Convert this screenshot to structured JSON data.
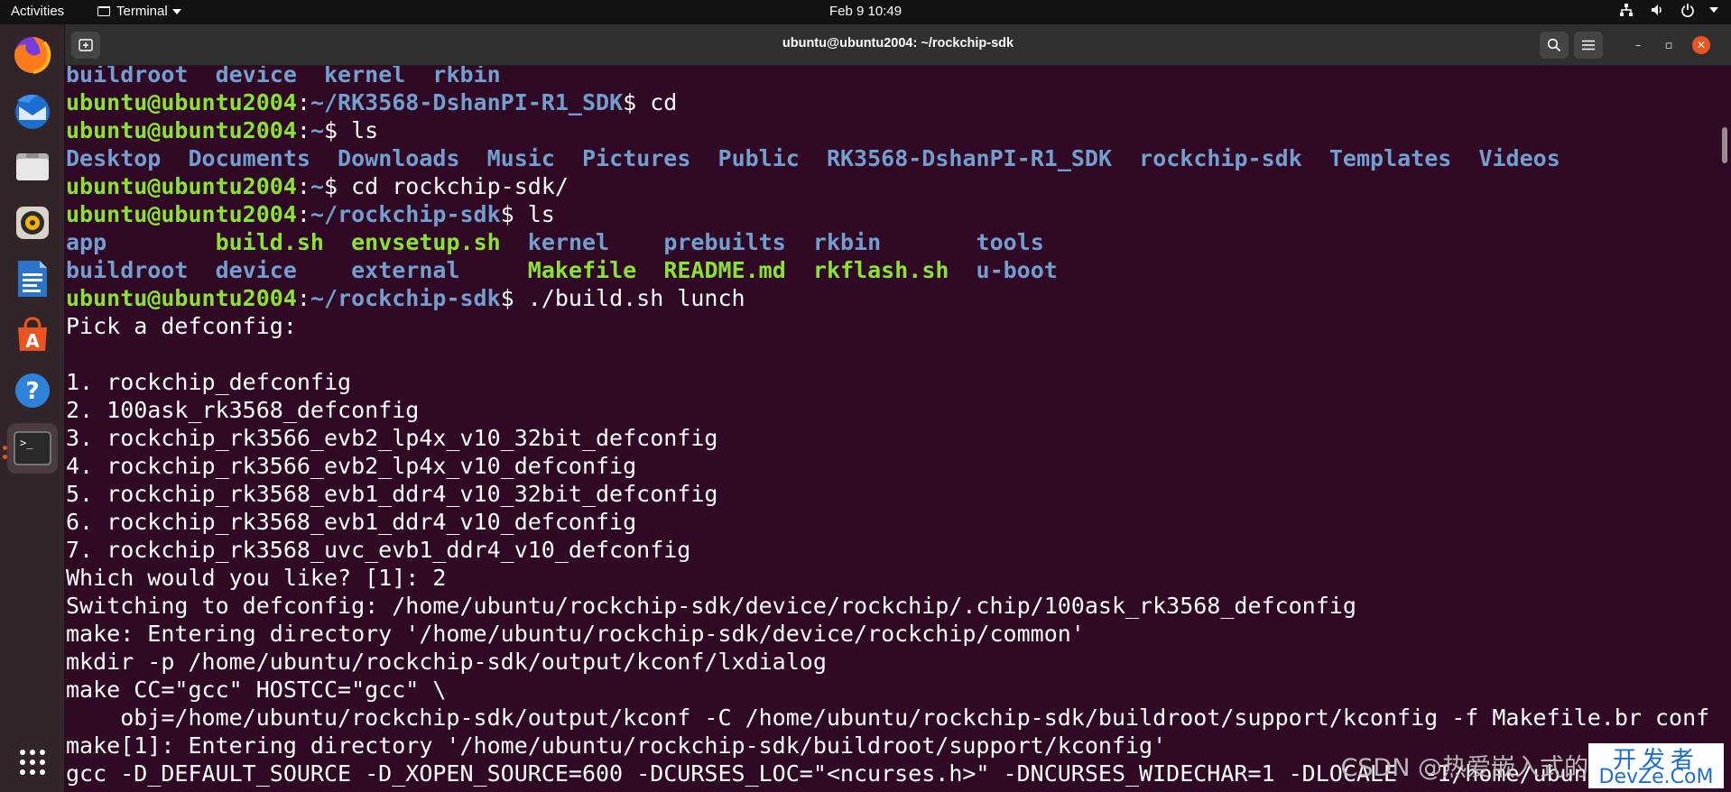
{
  "topbar": {
    "activities": "Activities",
    "app_name": "Terminal",
    "datetime": "Feb 9  10:49",
    "tray_icons": [
      "network-icon",
      "volume-icon",
      "power-icon",
      "chevron-down-icon"
    ]
  },
  "dock": {
    "items": [
      {
        "name": "firefox-icon",
        "running": false
      },
      {
        "name": "thunderbird-icon",
        "running": false
      },
      {
        "name": "files-icon",
        "running": false
      },
      {
        "name": "rhythmbox-icon",
        "running": false
      },
      {
        "name": "writer-icon",
        "running": false
      },
      {
        "name": "software-store-icon",
        "running": false
      },
      {
        "name": "help-icon",
        "running": false
      },
      {
        "name": "terminal-icon",
        "running": true
      }
    ],
    "show_apps": "apps-grid-icon"
  },
  "window": {
    "title": "ubuntu@ubuntu2004: ~/rockchip-sdk",
    "new_tab_icon": "new-tab-icon",
    "search_icon": "search-icon",
    "menu_icon": "hamburger-menu-icon",
    "minimize": "–",
    "maximize": "▫",
    "close": "✕"
  },
  "colors": {
    "terminal_bg": "#300a24",
    "user_host": "#8ae234",
    "path": "#729fcf",
    "directory": "#729fcf",
    "executable": "#8ae234",
    "text": "#ffffff",
    "accent": "#e95420"
  },
  "terminal": {
    "lines": [
      [
        {
          "t": "buildroot",
          "c": "dir"
        },
        {
          "t": "  "
        },
        {
          "t": "device",
          "c": "dir"
        },
        {
          "t": "  "
        },
        {
          "t": "kernel",
          "c": "dir"
        },
        {
          "t": "  "
        },
        {
          "t": "rkbin",
          "c": "dir"
        }
      ],
      [
        {
          "t": "ubuntu@ubuntu2004",
          "c": "pu"
        },
        {
          "t": ":"
        },
        {
          "t": "~/RK3568-DshanPI-R1_SDK",
          "c": "pp"
        },
        {
          "t": "$ cd"
        }
      ],
      [
        {
          "t": "ubuntu@ubuntu2004",
          "c": "pu"
        },
        {
          "t": ":"
        },
        {
          "t": "~",
          "c": "pp"
        },
        {
          "t": "$ ls"
        }
      ],
      [
        {
          "t": "Desktop",
          "c": "dir"
        },
        {
          "t": "  "
        },
        {
          "t": "Documents",
          "c": "dir"
        },
        {
          "t": "  "
        },
        {
          "t": "Downloads",
          "c": "dir"
        },
        {
          "t": "  "
        },
        {
          "t": "Music",
          "c": "dir"
        },
        {
          "t": "  "
        },
        {
          "t": "Pictures",
          "c": "dir"
        },
        {
          "t": "  "
        },
        {
          "t": "Public",
          "c": "dir"
        },
        {
          "t": "  "
        },
        {
          "t": "RK3568-DshanPI-R1_SDK",
          "c": "dir"
        },
        {
          "t": "  "
        },
        {
          "t": "rockchip-sdk",
          "c": "dir"
        },
        {
          "t": "  "
        },
        {
          "t": "Templates",
          "c": "dir"
        },
        {
          "t": "  "
        },
        {
          "t": "Videos",
          "c": "dir"
        }
      ],
      [
        {
          "t": "ubuntu@ubuntu2004",
          "c": "pu"
        },
        {
          "t": ":"
        },
        {
          "t": "~",
          "c": "pp"
        },
        {
          "t": "$ cd rockchip-sdk/"
        }
      ],
      [
        {
          "t": "ubuntu@ubuntu2004",
          "c": "pu"
        },
        {
          "t": ":"
        },
        {
          "t": "~/rockchip-sdk",
          "c": "pp"
        },
        {
          "t": "$ ls"
        }
      ],
      [
        {
          "t": "app",
          "c": "dir"
        },
        {
          "t": "        "
        },
        {
          "t": "build.sh",
          "c": "exe"
        },
        {
          "t": "  "
        },
        {
          "t": "envsetup.sh",
          "c": "exe"
        },
        {
          "t": "  "
        },
        {
          "t": "kernel",
          "c": "dir"
        },
        {
          "t": "    "
        },
        {
          "t": "prebuilts",
          "c": "dir"
        },
        {
          "t": "  "
        },
        {
          "t": "rkbin",
          "c": "dir"
        },
        {
          "t": "       "
        },
        {
          "t": "tools",
          "c": "dir"
        }
      ],
      [
        {
          "t": "buildroot",
          "c": "dir"
        },
        {
          "t": "  "
        },
        {
          "t": "device",
          "c": "dir"
        },
        {
          "t": "    "
        },
        {
          "t": "external",
          "c": "dir"
        },
        {
          "t": "     "
        },
        {
          "t": "Makefile",
          "c": "exe"
        },
        {
          "t": "  "
        },
        {
          "t": "README.md",
          "c": "exe"
        },
        {
          "t": "  "
        },
        {
          "t": "rkflash.sh",
          "c": "exe"
        },
        {
          "t": "  "
        },
        {
          "t": "u-boot",
          "c": "dir"
        }
      ],
      [
        {
          "t": "ubuntu@ubuntu2004",
          "c": "pu"
        },
        {
          "t": ":"
        },
        {
          "t": "~/rockchip-sdk",
          "c": "pp"
        },
        {
          "t": "$ ./build.sh lunch"
        }
      ],
      [
        {
          "t": "Pick a defconfig:"
        }
      ],
      [
        {
          "t": ""
        }
      ],
      [
        {
          "t": "1. rockchip_defconfig"
        }
      ],
      [
        {
          "t": "2. 100ask_rk3568_defconfig"
        }
      ],
      [
        {
          "t": "3. rockchip_rk3566_evb2_lp4x_v10_32bit_defconfig"
        }
      ],
      [
        {
          "t": "4. rockchip_rk3566_evb2_lp4x_v10_defconfig"
        }
      ],
      [
        {
          "t": "5. rockchip_rk3568_evb1_ddr4_v10_32bit_defconfig"
        }
      ],
      [
        {
          "t": "6. rockchip_rk3568_evb1_ddr4_v10_defconfig"
        }
      ],
      [
        {
          "t": "7. rockchip_rk3568_uvc_evb1_ddr4_v10_defconfig"
        }
      ],
      [
        {
          "t": "Which would you like? [1]: 2"
        }
      ],
      [
        {
          "t": "Switching to defconfig: /home/ubuntu/rockchip-sdk/device/rockchip/.chip/100ask_rk3568_defconfig"
        }
      ],
      [
        {
          "t": "make: Entering directory '/home/ubuntu/rockchip-sdk/device/rockchip/common'"
        }
      ],
      [
        {
          "t": "mkdir -p /home/ubuntu/rockchip-sdk/output/kconf/lxdialog"
        }
      ],
      [
        {
          "t": "make CC=\"gcc\" HOSTCC=\"gcc\" \\"
        }
      ],
      [
        {
          "t": "    obj=/home/ubuntu/rockchip-sdk/output/kconf -C /home/ubuntu/rockchip-sdk/buildroot/support/kconfig -f Makefile.br conf"
        }
      ],
      [
        {
          "t": "make[1]: Entering directory '/home/ubuntu/rockchip-sdk/buildroot/support/kconfig'"
        }
      ],
      [
        {
          "t": "gcc -D_DEFAULT_SOURCE -D_XOPEN_SOURCE=600 -DCURSES_LOC=\"<ncurses.h>\" -DNCURSES_WIDECHAR=1 -DLOCALE  -I/home/ubuntu/"
        }
      ]
    ]
  },
  "watermark": {
    "csdn": "CSDN @热爱嵌入式的",
    "logo_cn": "开发者",
    "logo_en": "DevZe.CoM"
  }
}
